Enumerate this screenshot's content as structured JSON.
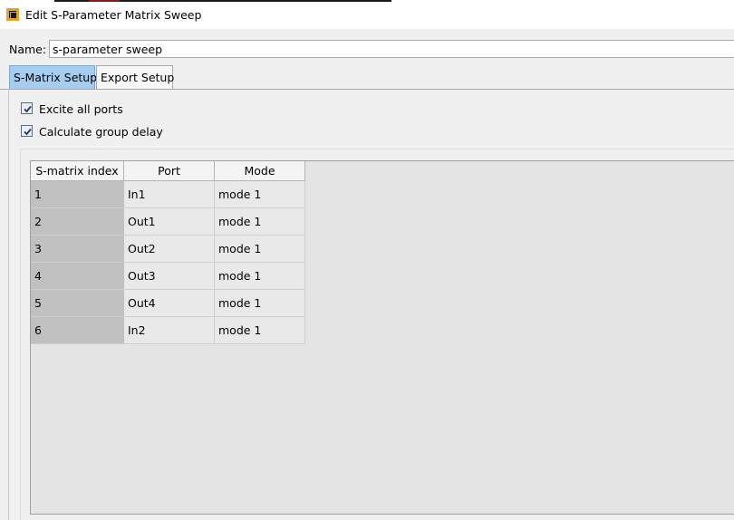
{
  "window": {
    "title": "Edit S-Parameter Matrix Sweep"
  },
  "name": {
    "label": "Name:",
    "value": "s-parameter sweep"
  },
  "tabs": [
    {
      "label": "S-Matrix Setup",
      "active": true
    },
    {
      "label": "Export Setup",
      "active": false
    }
  ],
  "options": [
    {
      "label": "Excite all ports",
      "checked": true
    },
    {
      "label": "Calculate group delay",
      "checked": true
    }
  ],
  "table": {
    "columns": [
      "S-matrix index",
      "Port",
      "Mode"
    ],
    "rows": [
      [
        "1",
        "In1",
        "mode 1"
      ],
      [
        "2",
        "Out1",
        "mode 1"
      ],
      [
        "3",
        "Out2",
        "mode 1"
      ],
      [
        "4",
        "Out3",
        "mode 1"
      ],
      [
        "5",
        "Out4",
        "mode 1"
      ],
      [
        "6",
        "In2",
        "mode 1"
      ]
    ]
  },
  "colors": {
    "active_tab": "#a4cdf0",
    "app_icon": "#e0a52a",
    "checkbox_mark": "#1f3a5a",
    "index_column": "#c0c0c0"
  }
}
